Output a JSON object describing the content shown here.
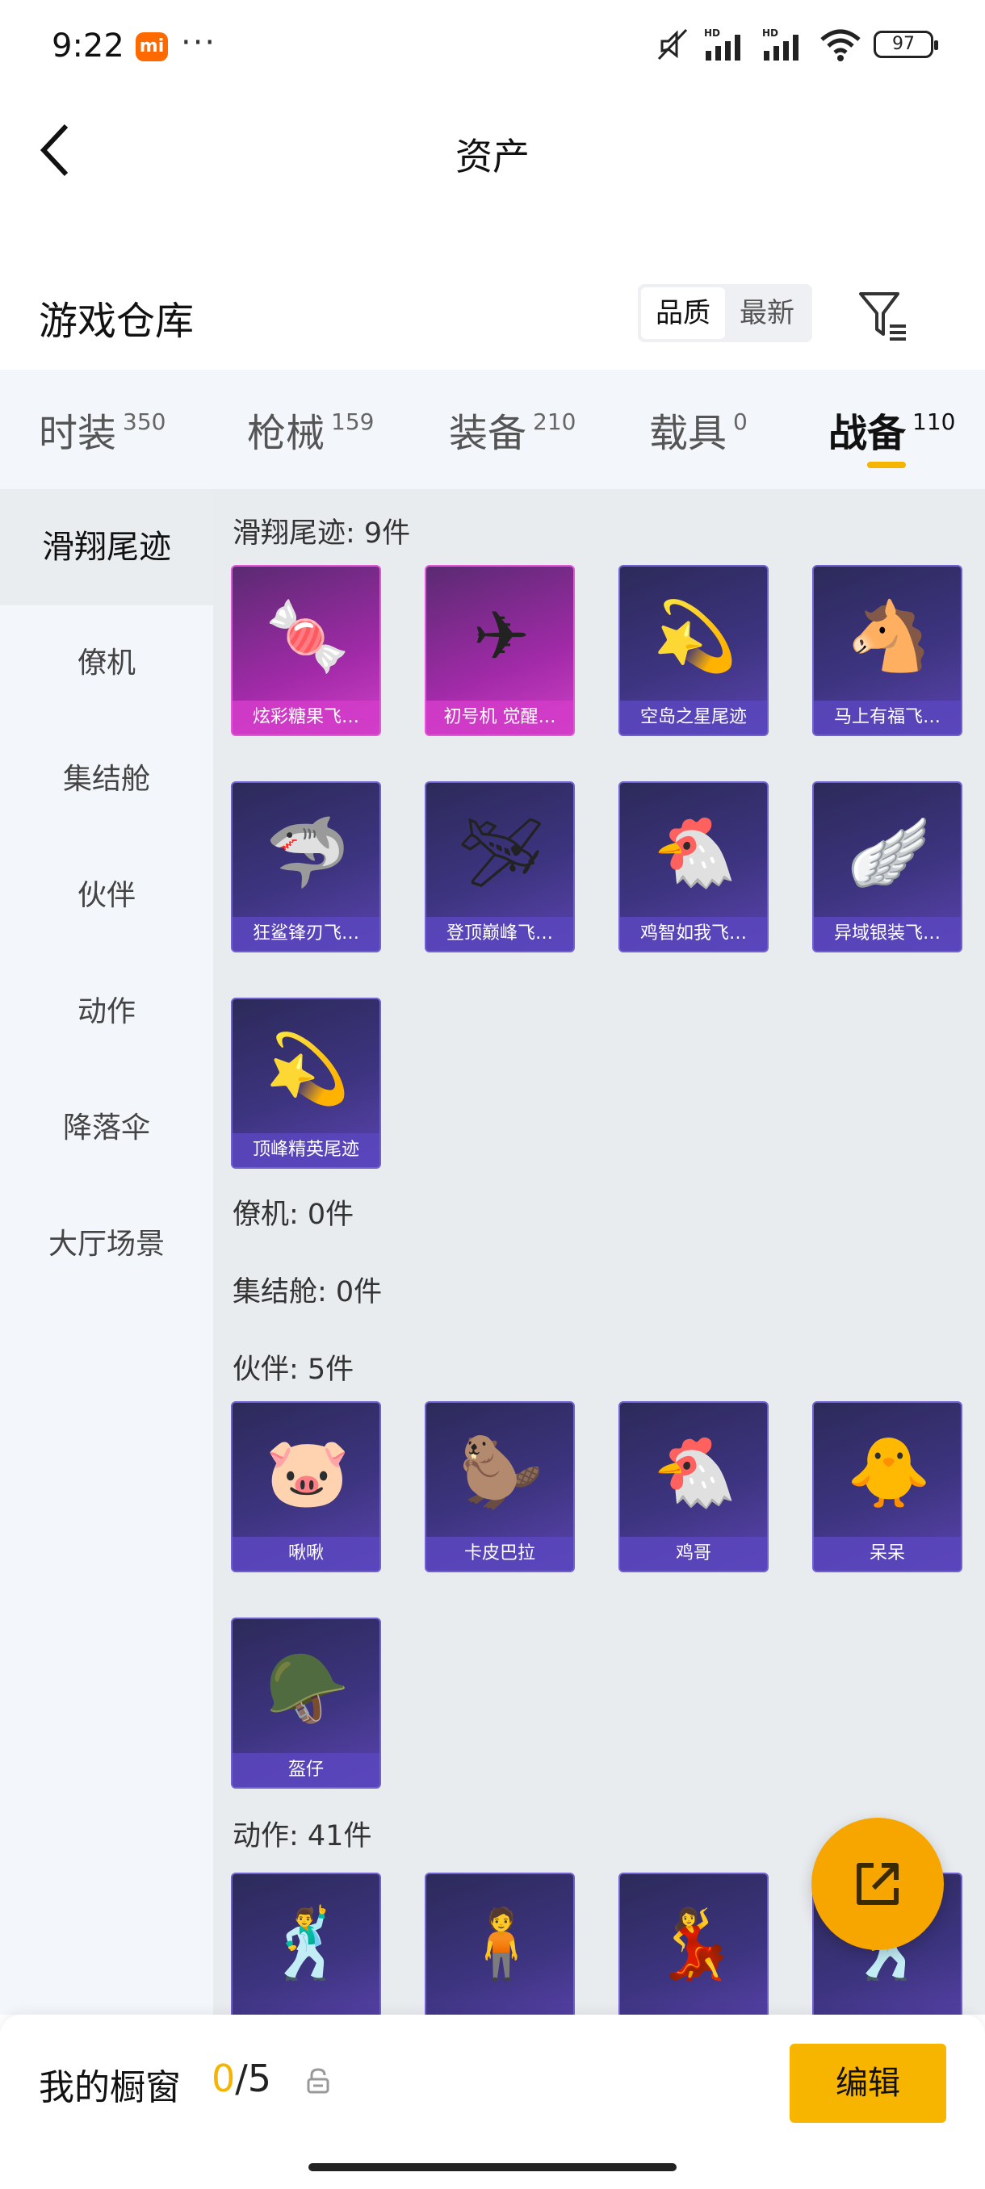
{
  "status": {
    "time": "9:22",
    "brand": "mi",
    "dots": "···",
    "battery": "97",
    "signal1": "HD",
    "signal2": "HD"
  },
  "header": {
    "title": "资产"
  },
  "warehouse": {
    "label": "游戏仓库",
    "sort_options": [
      "品质",
      "最新"
    ],
    "sort_active": 0
  },
  "tabs": [
    {
      "name": "时装",
      "count": "350"
    },
    {
      "name": "枪械",
      "count": "159"
    },
    {
      "name": "装备",
      "count": "210"
    },
    {
      "name": "载具",
      "count": "0"
    },
    {
      "name": "战备",
      "count": "110"
    }
  ],
  "active_tab": 4,
  "sidebar": [
    {
      "label": "滑翔尾迹"
    },
    {
      "label": "僚机"
    },
    {
      "label": "集结舱"
    },
    {
      "label": "伙伴"
    },
    {
      "label": "动作"
    },
    {
      "label": "降落伞"
    },
    {
      "label": "大厅场景"
    }
  ],
  "sections": {
    "glide": {
      "title": "滑翔尾迹: 9件",
      "items": [
        {
          "name": "炫彩糖果飞…",
          "art": "🍬",
          "rarity": "pink"
        },
        {
          "name": "初号机 觉醒…",
          "art": "✈",
          "rarity": "pink"
        },
        {
          "name": "空岛之星尾迹",
          "art": "💫",
          "rarity": "purple"
        },
        {
          "name": "马上有福飞…",
          "art": "🐴",
          "rarity": "purple"
        },
        {
          "name": "狂鲨锋刃飞…",
          "art": "🦈",
          "rarity": "purple"
        },
        {
          "name": "登顶巅峰飞…",
          "art": "🛩",
          "rarity": "purple"
        },
        {
          "name": "鸡智如我飞…",
          "art": "🐔",
          "rarity": "purple"
        },
        {
          "name": "异域银装飞…",
          "art": "🪽",
          "rarity": "purple"
        },
        {
          "name": "顶峰精英尾迹",
          "art": "💫",
          "rarity": "purple"
        }
      ]
    },
    "wingman": {
      "title": "僚机: 0件"
    },
    "pod": {
      "title": "集结舱: 0件"
    },
    "partner": {
      "title": "伙伴: 5件",
      "items": [
        {
          "name": "啾啾",
          "art": "🐷",
          "rarity": "purple"
        },
        {
          "name": "卡皮巴拉",
          "art": "🦫",
          "rarity": "purple"
        },
        {
          "name": "鸡哥",
          "art": "🐔",
          "rarity": "purple"
        },
        {
          "name": "呆呆",
          "art": "🐥",
          "rarity": "purple"
        },
        {
          "name": "盔仔",
          "art": "🪖",
          "rarity": "purple"
        }
      ]
    },
    "action": {
      "title": "动作: 41件",
      "items": [
        {
          "name": "",
          "art": "🕺",
          "rarity": "purple"
        },
        {
          "name": "",
          "art": "🧍",
          "rarity": "purple"
        },
        {
          "name": "",
          "art": "💃",
          "rarity": "purple"
        },
        {
          "name": "",
          "art": "🕺",
          "rarity": "purple"
        }
      ]
    }
  },
  "bottom": {
    "label": "我的橱窗",
    "current": "0",
    "sep": "/",
    "max": "5",
    "edit_label": "编辑"
  }
}
